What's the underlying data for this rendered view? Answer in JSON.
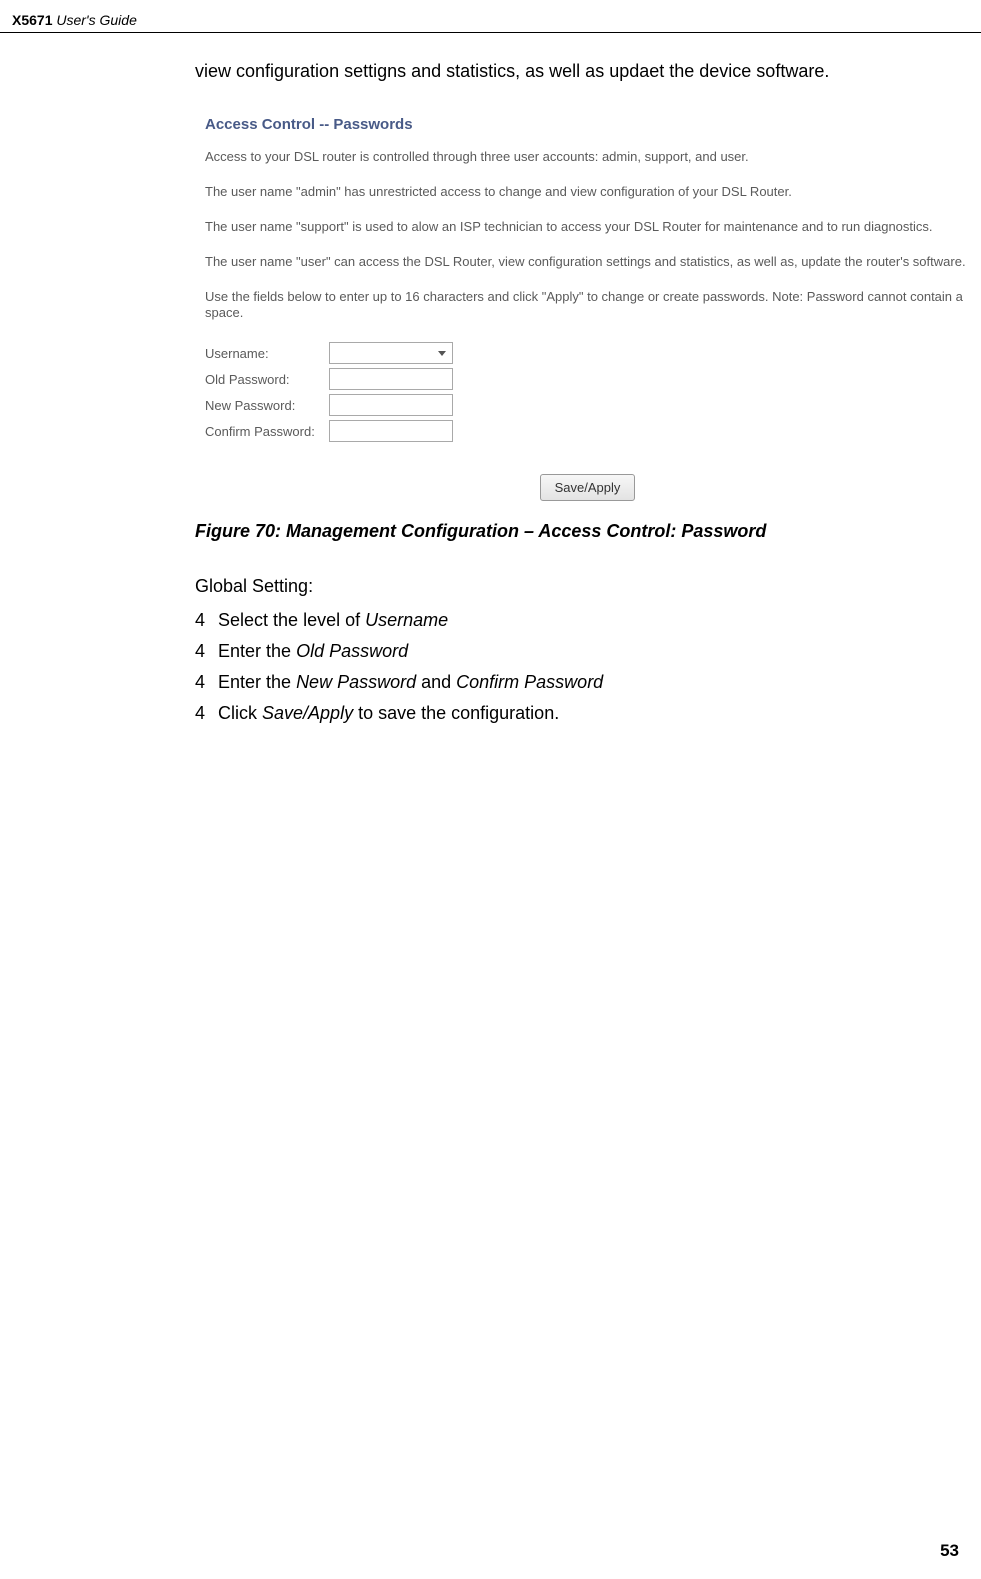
{
  "header": {
    "model": "X5671",
    "rest": " User's Guide"
  },
  "intro": "view configuration settigns and statistics, as well as updaet the device software.",
  "shot": {
    "title": "Access Control -- Passwords",
    "p1": "Access to your DSL router is controlled through three user accounts: admin, support, and user.",
    "p2": "The user name \"admin\" has unrestricted access to change and view configuration of your DSL Router.",
    "p3": "The user name \"support\" is used to alow an ISP technician to access your DSL Router for maintenance and to run diagnostics.",
    "p4": "The user name \"user\" can access the DSL Router, view configuration settings and statistics, as well as, update the router's software.",
    "p5": "Use the fields below to enter up to 16 characters and click \"Apply\" to change or create passwords. Note: Password cannot contain a space.",
    "form": {
      "username_label": "Username:",
      "old_label": "Old Password:",
      "new_label": "New Password:",
      "confirm_label": "Confirm Password:"
    },
    "button": "Save/Apply"
  },
  "caption": "Figure 70: Management Configuration – Access Control: Password",
  "global_heading": "Global Setting:",
  "steps": [
    {
      "num": "4",
      "before": "Select the level of ",
      "em": "Username",
      "after": ""
    },
    {
      "num": "4",
      "before": "Enter the ",
      "em": "Old Password",
      "after": ""
    },
    {
      "num": "4",
      "before": "Enter the ",
      "em": "New Password",
      "mid": " and ",
      "em2": "Confirm Password",
      "after": ""
    },
    {
      "num": "4",
      "before": "Click ",
      "em": "Save/Apply",
      "after": " to save the configuration."
    }
  ],
  "page_number": "53"
}
